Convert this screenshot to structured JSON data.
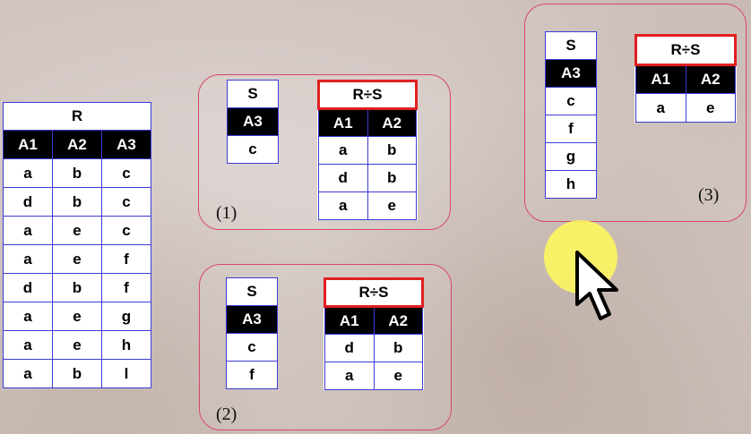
{
  "R": {
    "title": "R",
    "headers": [
      "A1",
      "A2",
      "A3"
    ],
    "rows": [
      [
        "a",
        "b",
        "c"
      ],
      [
        "d",
        "b",
        "c"
      ],
      [
        "a",
        "e",
        "c"
      ],
      [
        "a",
        "e",
        "f"
      ],
      [
        "d",
        "b",
        "f"
      ],
      [
        "a",
        "e",
        "g"
      ],
      [
        "a",
        "e",
        "h"
      ],
      [
        "a",
        "b",
        "l"
      ]
    ]
  },
  "groups": [
    {
      "label": "(1)",
      "S": {
        "title": "S",
        "header": "A3",
        "rows": [
          "c"
        ]
      },
      "result": {
        "title": "R÷S",
        "headers": [
          "A1",
          "A2"
        ],
        "rows": [
          [
            "a",
            "b"
          ],
          [
            "d",
            "b"
          ],
          [
            "a",
            "e"
          ]
        ]
      }
    },
    {
      "label": "(2)",
      "S": {
        "title": "S",
        "header": "A3",
        "rows": [
          "c",
          "f"
        ]
      },
      "result": {
        "title": "R÷S",
        "headers": [
          "A1",
          "A2"
        ],
        "rows": [
          [
            "d",
            "b"
          ],
          [
            "a",
            "e"
          ]
        ]
      }
    },
    {
      "label": "(3)",
      "S": {
        "title": "S",
        "header": "A3",
        "rows": [
          "c",
          "f",
          "g",
          "h"
        ]
      },
      "result": {
        "title": "R÷S",
        "headers": [
          "A1",
          "A2"
        ],
        "rows": [
          [
            "a",
            "e"
          ]
        ]
      }
    }
  ],
  "colors": {
    "border": "#3b3bd6",
    "highlight": "#e02020",
    "group_border": "#d9466a",
    "cursor_halo": "#fffa5a"
  },
  "icons": {
    "cursor": "mouse-pointer-icon"
  }
}
